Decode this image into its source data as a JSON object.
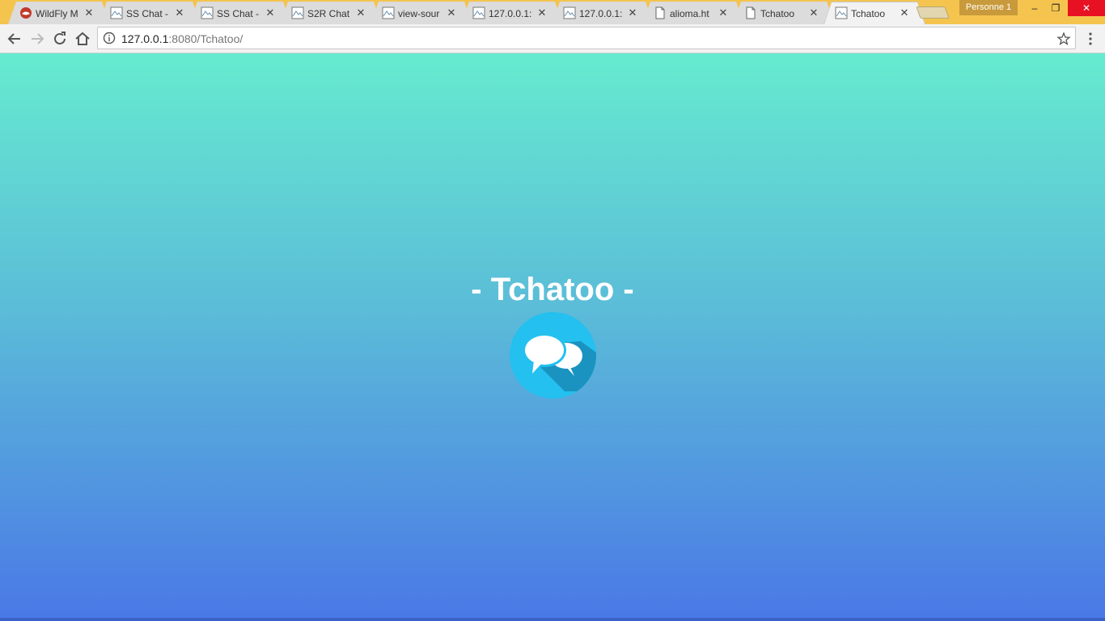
{
  "browser": {
    "tabs": [
      {
        "title": "WildFly M",
        "icon": "wildfly-icon",
        "active": false
      },
      {
        "title": "SS Chat -",
        "icon": "page-thumbnail-icon",
        "active": false
      },
      {
        "title": "SS Chat -",
        "icon": "page-thumbnail-icon",
        "active": false
      },
      {
        "title": "S2R Chat",
        "icon": "page-thumbnail-icon",
        "active": false
      },
      {
        "title": "view-sour",
        "icon": "page-thumbnail-icon",
        "active": false
      },
      {
        "title": "127.0.0.1:",
        "icon": "page-thumbnail-icon",
        "active": false
      },
      {
        "title": "127.0.0.1:",
        "icon": "page-thumbnail-icon",
        "active": false
      },
      {
        "title": "alioma.ht",
        "icon": "document-icon",
        "active": false
      },
      {
        "title": "Tchatoo",
        "icon": "document-icon",
        "active": false
      },
      {
        "title": "Tchatoo",
        "icon": "page-thumbnail-icon",
        "active": true
      }
    ],
    "tab_close_glyph": "✕",
    "profile_label": "Personne 1",
    "window_controls": {
      "minimize": "–",
      "maximize": "❐",
      "close": "✕"
    },
    "address": {
      "host": "127.0.0.1",
      "rest": ":8080/Tchatoo/"
    }
  },
  "page": {
    "title": "- Tchatoo -",
    "logo_icon": "chat-bubbles-icon",
    "colors": {
      "gradient_top": "#66ebcf",
      "gradient_bottom": "#4a78e6",
      "logo_circle": "#24c0ef"
    }
  }
}
